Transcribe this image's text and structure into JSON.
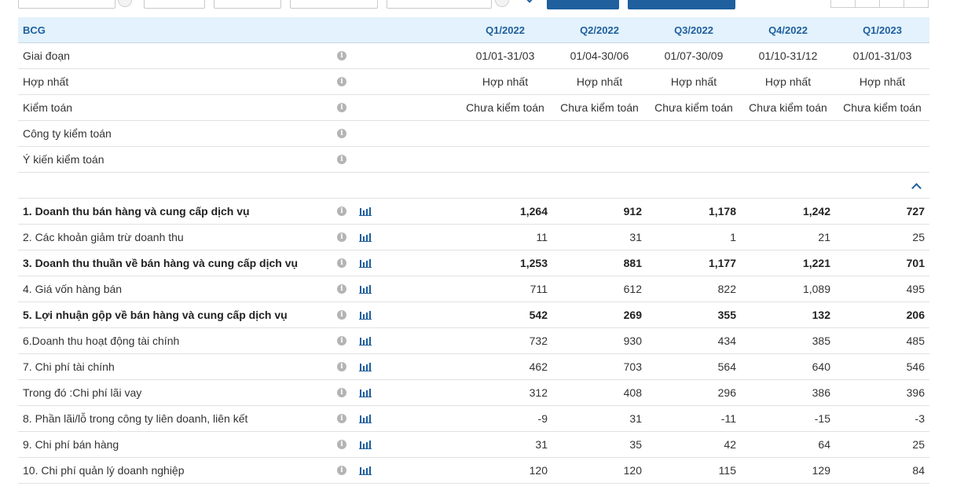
{
  "header": {
    "ticker": "BCG",
    "periods": [
      "Q1/2022",
      "Q2/2022",
      "Q3/2022",
      "Q4/2022",
      "Q1/2023"
    ]
  },
  "meta_rows": [
    {
      "label": "Giai đoạn",
      "values": [
        "01/01-31/03",
        "01/04-30/06",
        "01/07-30/09",
        "01/10-31/12",
        "01/01-31/03"
      ]
    },
    {
      "label": "Hợp nhất",
      "values": [
        "Hợp nhất",
        "Hợp nhất",
        "Hợp nhất",
        "Hợp nhất",
        "Hợp nhất"
      ]
    },
    {
      "label": "Kiểm toán",
      "values": [
        "Chưa kiểm toán",
        "Chưa kiểm toán",
        "Chưa kiểm toán",
        "Chưa kiểm toán",
        "Chưa kiểm toán"
      ]
    },
    {
      "label": "Công ty kiểm toán",
      "values": [
        "",
        "",
        "",
        "",
        ""
      ]
    },
    {
      "label": "Ý kiến kiểm toán",
      "values": [
        "",
        "",
        "",
        "",
        ""
      ]
    }
  ],
  "data_rows": [
    {
      "label": "1. Doanh thu bán hàng và cung cấp dịch vụ",
      "values": [
        "1,264",
        "912",
        "1,178",
        "1,242",
        "727"
      ]
    },
    {
      "label": "2. Các khoản giảm trừ doanh thu",
      "values": [
        "11",
        "31",
        "1",
        "21",
        "25"
      ]
    },
    {
      "label": "3. Doanh thu thuần về bán hàng và cung cấp dịch vụ",
      "values": [
        "1,253",
        "881",
        "1,177",
        "1,221",
        "701"
      ]
    },
    {
      "label": "4. Giá vốn hàng bán",
      "values": [
        "711",
        "612",
        "822",
        "1,089",
        "495"
      ]
    },
    {
      "label": "5. Lợi nhuận gộp về bán hàng và cung cấp dịch vụ",
      "values": [
        "542",
        "269",
        "355",
        "132",
        "206"
      ]
    },
    {
      "label": "6.Doanh thu hoạt động tài chính",
      "values": [
        "732",
        "930",
        "434",
        "385",
        "485"
      ]
    },
    {
      "label": "7. Chi phí tài chính",
      "values": [
        "462",
        "703",
        "564",
        "640",
        "546"
      ]
    },
    {
      "label": "Trong đó :Chi phí lãi vay",
      "values": [
        "312",
        "408",
        "296",
        "386",
        "396"
      ]
    },
    {
      "label": "8. Phần lãi/lỗ trong công ty liên doanh, liên kết",
      "values": [
        "-9",
        "31",
        "-11",
        "-15",
        "-3"
      ]
    },
    {
      "label": "9. Chi phí bán hàng",
      "values": [
        "31",
        "35",
        "42",
        "64",
        "25"
      ]
    },
    {
      "label": "10. Chi phí quản lý doanh nghiệp",
      "values": [
        "120",
        "120",
        "115",
        "129",
        "84"
      ]
    }
  ],
  "icons": {
    "info": "info-icon",
    "chart": "bar-chart-icon",
    "collapse": "chevron-up-icon"
  },
  "colors": {
    "accent": "#1f5f9e",
    "header_bg": "#e3f2fc"
  }
}
